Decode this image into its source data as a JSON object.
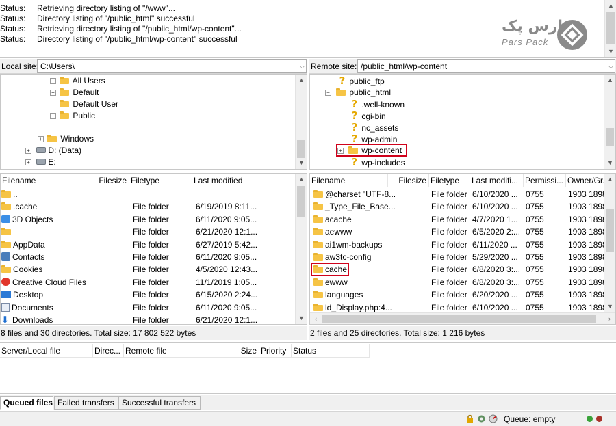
{
  "status_log": [
    {
      "label": "Status:",
      "text": "Retrieving directory listing of \"/www\"..."
    },
    {
      "label": "Status:",
      "text": "Directory listing of \"/public_html\" successful"
    },
    {
      "label": "Status:",
      "text": "Retrieving directory listing of \"/public_html/wp-content\"..."
    },
    {
      "label": "Status:",
      "text": "Directory listing of \"/public_html/wp-content\" successful"
    }
  ],
  "logo": {
    "fa": "پارس پک",
    "en": "Pars Pack"
  },
  "local": {
    "site_label": "Local site:",
    "site_path": "C:\\Users\\",
    "tree": [
      {
        "label": "All Users",
        "expander": "+"
      },
      {
        "label": "Default",
        "expander": "+"
      },
      {
        "label": "Default User",
        "expander": ""
      },
      {
        "label": "Public",
        "expander": "+"
      },
      {
        "label": "Windows",
        "expander": "+"
      },
      {
        "label": "D: (Data)",
        "expander": "+"
      },
      {
        "label": "E:",
        "expander": "+"
      }
    ],
    "columns": [
      "Filename",
      "Filesize",
      "Filetype",
      "Last modified"
    ],
    "files": [
      {
        "name": "..",
        "type": "",
        "modified": ""
      },
      {
        "name": ".cache",
        "type": "File folder",
        "modified": "6/19/2019 8:11..."
      },
      {
        "name": "3D Objects",
        "type": "File folder",
        "modified": "6/11/2020 9:05..."
      },
      {
        "name": "",
        "type": "File folder",
        "modified": "6/21/2020 12:1..."
      },
      {
        "name": "AppData",
        "type": "File folder",
        "modified": "6/27/2019 5:42..."
      },
      {
        "name": "Contacts",
        "type": "File folder",
        "modified": "6/11/2020 9:05..."
      },
      {
        "name": "Cookies",
        "type": "File folder",
        "modified": "4/5/2020 12:43..."
      },
      {
        "name": "Creative Cloud Files",
        "type": "File folder",
        "modified": "11/1/2019 1:05..."
      },
      {
        "name": "Desktop",
        "type": "File folder",
        "modified": "6/15/2020 2:24..."
      },
      {
        "name": "Documents",
        "type": "File folder",
        "modified": "6/11/2020 9:05..."
      },
      {
        "name": "Downloads",
        "type": "File folder",
        "modified": "6/21/2020 12:1..."
      }
    ],
    "summary": "8 files and 30 directories. Total size: 17 802 522 bytes"
  },
  "remote": {
    "site_label": "Remote site:",
    "site_path": "/public_html/wp-content",
    "tree": [
      {
        "label": "public_ftp"
      },
      {
        "label": "public_html"
      },
      {
        "label": ".well-known"
      },
      {
        "label": "cgi-bin"
      },
      {
        "label": "nc_assets"
      },
      {
        "label": "wp-admin"
      },
      {
        "label": "wp-content"
      },
      {
        "label": "wp-includes"
      }
    ],
    "columns": [
      "Filename",
      "Filesize",
      "Filetype",
      "Last modifi...",
      "Permissi...",
      "Owner/Gr..."
    ],
    "files": [
      {
        "name": "@charset \"UTF-8...",
        "type": "File folder",
        "modified": "6/10/2020 ...",
        "perm": "0755",
        "owner": "1903 1898"
      },
      {
        "name": "_Type_File_Base...",
        "type": "File folder",
        "modified": "6/10/2020 ...",
        "perm": "0755",
        "owner": "1903 1898"
      },
      {
        "name": "acache",
        "type": "File folder",
        "modified": "4/7/2020 1...",
        "perm": "0755",
        "owner": "1903 1898"
      },
      {
        "name": "aewww",
        "type": "File folder",
        "modified": "6/5/2020 2:...",
        "perm": "0755",
        "owner": "1903 1898"
      },
      {
        "name": "ai1wm-backups",
        "type": "File folder",
        "modified": "6/11/2020 ...",
        "perm": "0755",
        "owner": "1903 1898"
      },
      {
        "name": "aw3tc-config",
        "type": "File folder",
        "modified": "5/29/2020 ...",
        "perm": "0755",
        "owner": "1903 1898"
      },
      {
        "name": "cache",
        "type": "File folder",
        "modified": "6/8/2020 3:...",
        "perm": "0755",
        "owner": "1903 1898"
      },
      {
        "name": "ewww",
        "type": "File folder",
        "modified": "6/8/2020 3:...",
        "perm": "0755",
        "owner": "1903 1898"
      },
      {
        "name": "languages",
        "type": "File folder",
        "modified": "6/20/2020 ...",
        "perm": "0755",
        "owner": "1903 1898"
      },
      {
        "name": "ld_Display.php:4...",
        "type": "File folder",
        "modified": "6/10/2020 ...",
        "perm": "0755",
        "owner": "1903 1898"
      }
    ],
    "summary": "2 files and 25 directories. Total size: 1 216 bytes"
  },
  "queue": {
    "columns": [
      "Server/Local file",
      "Direc...",
      "Remote file",
      "Size",
      "Priority",
      "Status"
    ]
  },
  "tabs": [
    {
      "label": "Queued files",
      "active": true
    },
    {
      "label": "Failed transfers",
      "active": false
    },
    {
      "label": "Successful transfers",
      "active": false
    }
  ],
  "statusbar": {
    "queue_text": "Queue: empty"
  },
  "colors": {
    "highlight": "#d0021b",
    "folder": "#f6c445"
  }
}
